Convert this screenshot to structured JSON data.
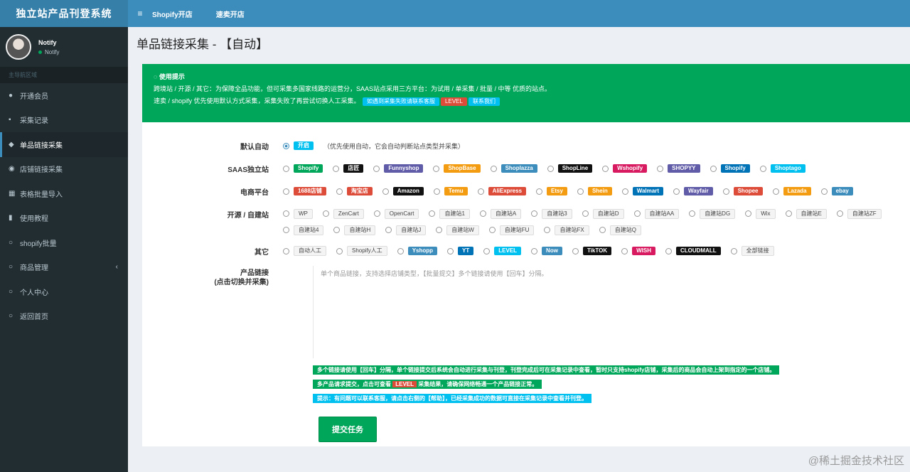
{
  "app": {
    "brand": "独立站产品刊登系统"
  },
  "topnav": {
    "toggle_icon": "≡",
    "links": [
      "Shopify开店",
      "速卖开店"
    ]
  },
  "user": {
    "name": "Notify",
    "status": "Notify"
  },
  "sidebar": {
    "header": "主导航区域",
    "items": [
      {
        "label": "开通会员",
        "icon": "users-icon"
      },
      {
        "label": "采集记录",
        "icon": "document-icon"
      },
      {
        "label": "单品链接采集",
        "icon": "link-icon"
      },
      {
        "label": "店铺链接采集",
        "icon": "store-icon"
      },
      {
        "label": "表格批量导入",
        "icon": "table-icon"
      },
      {
        "label": "使用教程",
        "icon": "book-icon"
      },
      {
        "label": "shopify批量",
        "icon": "circle-icon"
      },
      {
        "label": "商品管理",
        "icon": "circle-icon",
        "chevron": "‹"
      },
      {
        "label": "个人中心",
        "icon": "user-icon"
      },
      {
        "label": "返回首页",
        "icon": "circle-icon"
      }
    ]
  },
  "page": {
    "title": "单品链接采集 - 【自动】"
  },
  "alert": {
    "title": "使用提示",
    "line1": "跨境站 / 开源 / 其它：为保障全品功能，但可采集多国家线路的运营分，SAAS站点采用三方平台：为试用 / 单采集 / 批量 / 中等 优质的站点。",
    "line2_text": "速卖 / shopify 优先使用默认方式采集，采集失败了再尝试切换人工采集。",
    "line2_pill1": "如遇到采集失败请联系客服",
    "line2_pill2": "LEVEL",
    "line2_pill3": "联系我们"
  },
  "form": {
    "row1": {
      "label": "默认自动",
      "tag": "开启",
      "note": "（优先使用自动，它会自动判断站点类型并采集）"
    },
    "row2": {
      "label": "SAAS独立站",
      "tags": [
        {
          "text": "Shopify",
          "color": "#00a65a"
        },
        {
          "text": "店匠",
          "color": "#111111"
        },
        {
          "text": "Funnyshop",
          "color": "#605ca8"
        },
        {
          "text": "ShopBase",
          "color": "#f39c12"
        },
        {
          "text": "Shoplazza",
          "color": "#3c8dbc"
        },
        {
          "text": "ShopLine",
          "color": "#111111"
        },
        {
          "text": "Wshopify",
          "color": "#d81b60"
        },
        {
          "text": "SHOPYY",
          "color": "#605ca8"
        },
        {
          "text": "Shopify",
          "color": "#0073b7"
        },
        {
          "text": "Shoptago",
          "color": "#00c0ef"
        }
      ]
    },
    "row3": {
      "label": "电商平台",
      "tags": [
        {
          "text": "1688店铺",
          "color": "#dd4b39"
        },
        {
          "text": "淘宝店",
          "color": "#dd4b39"
        },
        {
          "text": "Amazon",
          "color": "#111111"
        },
        {
          "text": "Temu",
          "color": "#f39c12"
        },
        {
          "text": "AliExpress",
          "color": "#dd4b39"
        },
        {
          "text": "Etsy",
          "color": "#f39c12"
        },
        {
          "text": "Shein",
          "color": "#f39c12"
        },
        {
          "text": "Walmart",
          "color": "#0073b7"
        },
        {
          "text": "Wayfair",
          "color": "#605ca8"
        },
        {
          "text": "Shopee",
          "color": "#dd4b39"
        },
        {
          "text": "Lazada",
          "color": "#f39c12"
        },
        {
          "text": "ebay",
          "color": "#3c8dbc"
        }
      ]
    },
    "row4": {
      "label": "开源 / 自建站",
      "tags": [
        "WP",
        "ZenCart",
        "OpenCart",
        "自建站1",
        "自建站A",
        "自建站3",
        "自建站D",
        "自建站AA",
        "自建站DG",
        "Wix",
        "自建站E",
        "自建站ZF",
        "自建站4",
        "自建站H",
        "自建站J",
        "自建站W",
        "自建站FU",
        "自建站FX",
        "自建站Q"
      ]
    },
    "row5": {
      "label": "其它",
      "tags": [
        {
          "text": "自动人工",
          "color": "",
          "light": true
        },
        {
          "text": "Shopify人工",
          "color": "",
          "light": true
        },
        {
          "text": "Yshopp",
          "color": "#3c8dbc"
        },
        {
          "text": "YT",
          "color": "#0073b7"
        },
        {
          "text": "LEVEL",
          "color": "#00c0ef"
        },
        {
          "text": "Now",
          "color": "#3c8dbc"
        },
        {
          "text": "TikTOK",
          "color": "#111111"
        },
        {
          "text": "WISH",
          "color": "#d81b60"
        },
        {
          "text": "CLOUDMALL",
          "color": "#111111"
        },
        {
          "text": "全部链接",
          "color": "",
          "light": true
        }
      ]
    },
    "row6": {
      "label_line1": "产品链接",
      "label_line2": "(点击切换并采集)",
      "placeholder": "单个商品链接，支持选择店铺类型，【批量提交】多个链接请使用【回车】分隔。"
    }
  },
  "tips": {
    "tip1": "多个链接请使用【回车】分隔，单个链接提交后系统会自动进行采集与刊登，刊登完成后可在采集记录中查看，暂时只支持shopify店铺，采集后的商品会自动上架到指定的一个店铺。",
    "tip2_text": "多产品请求提交，点击可查看",
    "tip2_pill": "LEVEL",
    "tip2_rest": "采集结果，请确保网络畅通一个产品链接正常。",
    "tip3": "提示：有问题可以联系客服，请点击右侧的【帮助】，已经采集成功的数据可直接在采集记录中查看并刊登。"
  },
  "submit_label": "提交任务",
  "watermark": "@稀土掘金技术社区"
}
